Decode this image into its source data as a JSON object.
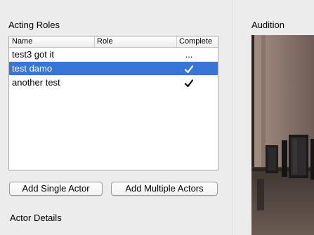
{
  "acting_roles": {
    "title": "Acting Roles",
    "columns": [
      "Name",
      "Role",
      "Complete"
    ],
    "rows": [
      {
        "name": "test3 got it",
        "role": "",
        "complete": "...",
        "complete_icon": "ellipsis",
        "selected": false
      },
      {
        "name": "test damo",
        "role": "",
        "complete": "",
        "complete_icon": "checkmark-icon",
        "selected": true
      },
      {
        "name": "another test",
        "role": "",
        "complete": "",
        "complete_icon": "checkmark-icon",
        "selected": false
      }
    ],
    "selection_color": "#3875d7"
  },
  "buttons": {
    "add_single": "Add Single Actor",
    "add_multiple": "Add Multiple Actors"
  },
  "audition": {
    "title": "Audition",
    "preview_icon": "video-preview"
  },
  "actor_details": {
    "title": "Actor Details"
  }
}
